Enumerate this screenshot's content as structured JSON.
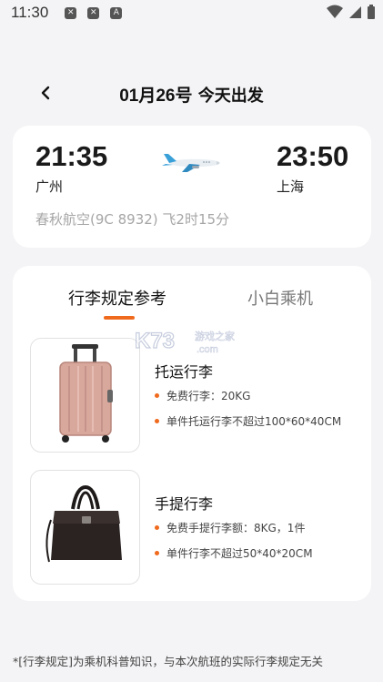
{
  "status_bar": {
    "time": "11:30"
  },
  "header": {
    "title_date": "01月26号",
    "title_suffix": " 今天出发"
  },
  "flight": {
    "depart_time": "21:35",
    "depart_city": "广州",
    "arrive_time": "23:50",
    "arrive_city": "上海",
    "airline_info": "春秋航空(9C 8932) 飞2时15分"
  },
  "tabs": [
    {
      "label": "行李规定参考",
      "active": true
    },
    {
      "label": "小白乘机",
      "active": false
    }
  ],
  "luggage": [
    {
      "title": "托运行李",
      "icon": "suitcase",
      "rules": [
        "免费行李：20KG",
        "单件托运行李不超过100*60*40CM"
      ]
    },
    {
      "title": "手提行李",
      "icon": "handbag",
      "rules": [
        "免费手提行李额：8KG，1件",
        "单件行李不超过50*40*20CM"
      ]
    }
  ],
  "watermark": {
    "brand": "K73",
    "text": "游戏之家",
    "domain": ".com"
  },
  "footnote": "*[行李规定]为乘机科普知识，与本次航班的实际行李规定无关",
  "colors": {
    "accent": "#f06a1e",
    "background": "#f4f4f6",
    "card": "#ffffff"
  }
}
